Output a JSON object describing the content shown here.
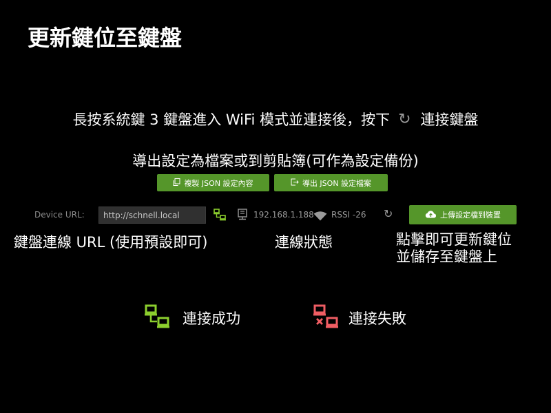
{
  "title": "更新鍵位至鍵盤",
  "instruction": {
    "before": "長按系統鍵 3 鍵盤進入 WiFi 模式並連接後，按下",
    "after": "連接鍵盤"
  },
  "export_text": "導出設定為檔案或到剪貼簿(可作為設定備份)",
  "copy_button": "複製 JSON 設定內容",
  "export_button": "導出 JSON 設定檔案",
  "device_url_label": "Device URL:",
  "device_url_value": "http://schnell.local",
  "ip": "192.168.1.188",
  "rssi": "RSSI -26",
  "upload_button": "上傳設定檔到裝置",
  "annotations": {
    "url": "鍵盤連線 URL (使用預設即可)",
    "status": "連線狀態",
    "click_line1": "點擊即可更新鍵位",
    "click_line2": "並儲存至鍵盤上"
  },
  "legend": {
    "success": "連接成功",
    "fail": "連接失敗"
  },
  "colors": {
    "accent_green": "#55962a",
    "success_icon": "#8ccf2e",
    "fail_icon": "#ef5d63"
  },
  "icons": [
    "refresh-icon",
    "copy-icon",
    "export-icon",
    "connection-ok-icon",
    "server-icon",
    "wifi-icon",
    "upload-cloud-icon",
    "connection-fail-icon"
  ]
}
